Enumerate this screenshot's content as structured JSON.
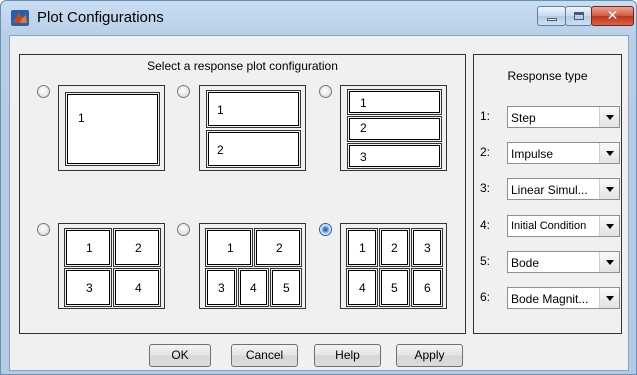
{
  "window": {
    "title": "Plot Configurations",
    "minimize_label": "",
    "maximize_label": "",
    "close_label": "✕"
  },
  "config_panel": {
    "title": "Select a response plot configuration",
    "selected_index": 5,
    "layouts": [
      {
        "cells": [
          "1"
        ]
      },
      {
        "cells": [
          "1",
          "2"
        ]
      },
      {
        "cells": [
          "1",
          "2",
          "3"
        ]
      },
      {
        "cells": [
          "1",
          "2",
          "3",
          "4"
        ]
      },
      {
        "cells": [
          "1",
          "2",
          "3",
          "4",
          "5"
        ]
      },
      {
        "cells": [
          "1",
          "2",
          "3",
          "4",
          "5",
          "6"
        ]
      }
    ]
  },
  "response_panel": {
    "title": "Response type",
    "rows": [
      {
        "num": "1:",
        "value": "Step"
      },
      {
        "num": "2:",
        "value": "Impulse"
      },
      {
        "num": "3:",
        "value": "Linear Simul..."
      },
      {
        "num": "4:",
        "value": "Initial Condition"
      },
      {
        "num": "5:",
        "value": "Bode"
      },
      {
        "num": "6:",
        "value": "Bode Magnit..."
      }
    ]
  },
  "buttons": {
    "ok": "OK",
    "cancel": "Cancel",
    "help": "Help",
    "apply": "Apply"
  },
  "colors": {
    "title_bar": "#b8cfe8",
    "close_button": "#c8432a",
    "selected_radio": "#1f62b8"
  }
}
